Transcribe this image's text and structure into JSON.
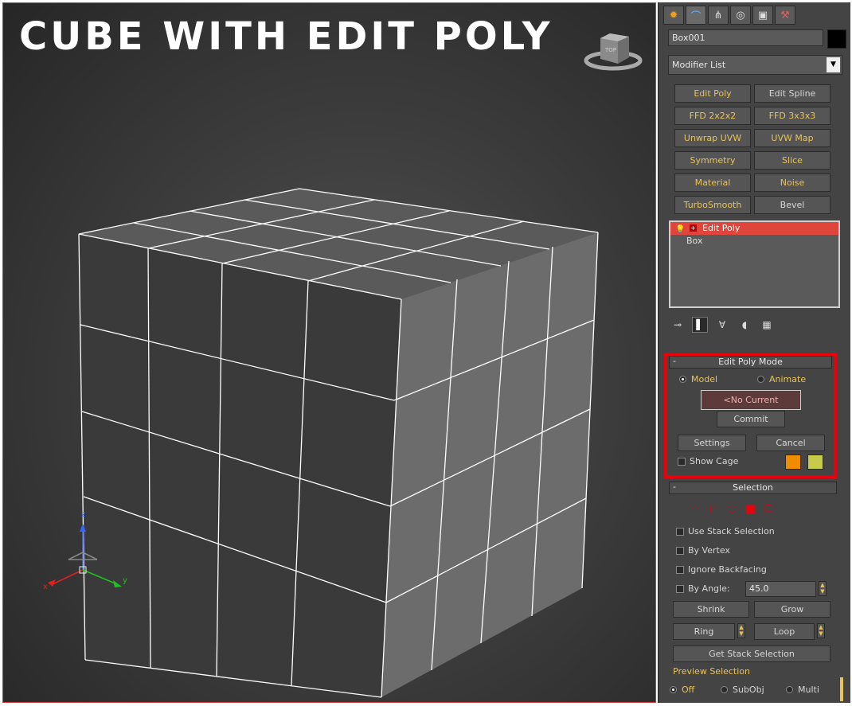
{
  "viewport": {
    "title": "CUBE WITH EDIT POLY",
    "viewcube_label": "TOP",
    "axis_labels": {
      "x": "x",
      "y": "y",
      "z": "z"
    }
  },
  "panel": {
    "tabs": [
      {
        "name": "create",
        "icon": "sun-icon"
      },
      {
        "name": "modify",
        "icon": "bend-icon"
      },
      {
        "name": "hierarchy",
        "icon": "hierarchy-icon"
      },
      {
        "name": "motion",
        "icon": "motion-icon"
      },
      {
        "name": "display",
        "icon": "monitor-icon"
      },
      {
        "name": "utilities",
        "icon": "hammer-icon"
      }
    ],
    "object_name": "Box001",
    "object_color": "#000000",
    "modifier_list": "Modifier List",
    "modifier_buttons": [
      {
        "label": "Edit Poly",
        "highlight": true
      },
      {
        "label": "Edit Spline",
        "highlight": false
      },
      {
        "label": "FFD 2x2x2",
        "highlight": true
      },
      {
        "label": "FFD 3x3x3",
        "highlight": true
      },
      {
        "label": "Unwrap UVW",
        "highlight": true
      },
      {
        "label": "UVW Map",
        "highlight": true
      },
      {
        "label": "Symmetry",
        "highlight": true
      },
      {
        "label": "Slice",
        "highlight": true
      },
      {
        "label": "Material",
        "highlight": true
      },
      {
        "label": "Noise",
        "highlight": true
      },
      {
        "label": "TurboSmooth",
        "highlight": true
      },
      {
        "label": "Bevel",
        "highlight": false
      }
    ],
    "stack": [
      {
        "label": "Edit Poly",
        "selected": true
      },
      {
        "label": "Box",
        "selected": false
      }
    ],
    "edit_poly_mode": {
      "header": "Edit Poly Mode",
      "model_label": "Model",
      "animate_label": "Animate",
      "current_operation": "<No Current Operation>",
      "commit_label": "Commit",
      "settings_label": "Settings",
      "cancel_label": "Cancel",
      "show_cage_label": "Show Cage",
      "cage_color_1": "#f08c00",
      "cage_color_2": "#c6cc4a"
    },
    "selection": {
      "header": "Selection",
      "use_stack_selection": "Use Stack Selection",
      "by_vertex": "By Vertex",
      "ignore_backfacing": "Ignore Backfacing",
      "by_angle": "By Angle:",
      "angle_value": "45.0",
      "shrink": "Shrink",
      "grow": "Grow",
      "ring": "Ring",
      "loop": "Loop",
      "get_stack_selection": "Get Stack Selection",
      "preview_selection": "Preview Selection",
      "preview_off": "Off",
      "preview_subobj": "SubObj",
      "preview_multi": "Multi"
    },
    "accent_red": "#e8000b"
  }
}
